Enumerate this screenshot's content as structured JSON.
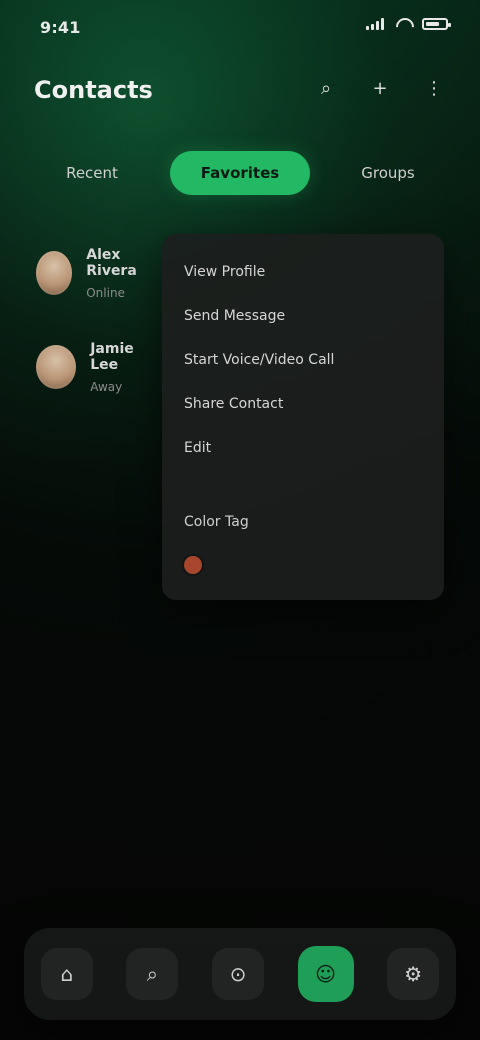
{
  "status_bar": {
    "time": "9:41",
    "battery_level": 0.72
  },
  "header": {
    "title": "Contacts",
    "actions": [
      {
        "icon": "search-icon",
        "glyph": "⌕"
      },
      {
        "icon": "plus-icon",
        "glyph": "+"
      },
      {
        "icon": "more-icon",
        "glyph": "⋮"
      }
    ]
  },
  "tabs": [
    {
      "label": "Recent",
      "active": false
    },
    {
      "label": "Favorites",
      "active": true
    },
    {
      "label": "Groups",
      "active": false
    }
  ],
  "people": [
    {
      "name": "Alex Rivera",
      "subtitle": "Online"
    },
    {
      "name": "Jamie Lee",
      "subtitle": "Away"
    }
  ],
  "panel": {
    "rows": [
      {
        "label": "View Profile"
      },
      {
        "label": "Send Message"
      },
      {
        "label": "Start Voice/Video Call"
      },
      {
        "label": "Share Contact"
      },
      {
        "label": "Edit"
      }
    ],
    "foot_label": "Color Tag",
    "foot_color": "#a6472d"
  },
  "bottom_nav": {
    "items": [
      {
        "icon": "home-icon",
        "glyph": "⌂",
        "active": false
      },
      {
        "icon": "search-icon",
        "glyph": "⌕",
        "active": false
      },
      {
        "icon": "compass-icon",
        "glyph": "⊙",
        "active": false
      },
      {
        "icon": "people-icon",
        "glyph": "☺",
        "active": true
      },
      {
        "icon": "settings-icon",
        "glyph": "⚙",
        "active": false
      }
    ]
  },
  "colors": {
    "accent": "#22b864",
    "accent_dark": "#1f9e57",
    "background": "#050605",
    "panel": "#1c1e1d",
    "warning": "#a6472d"
  }
}
